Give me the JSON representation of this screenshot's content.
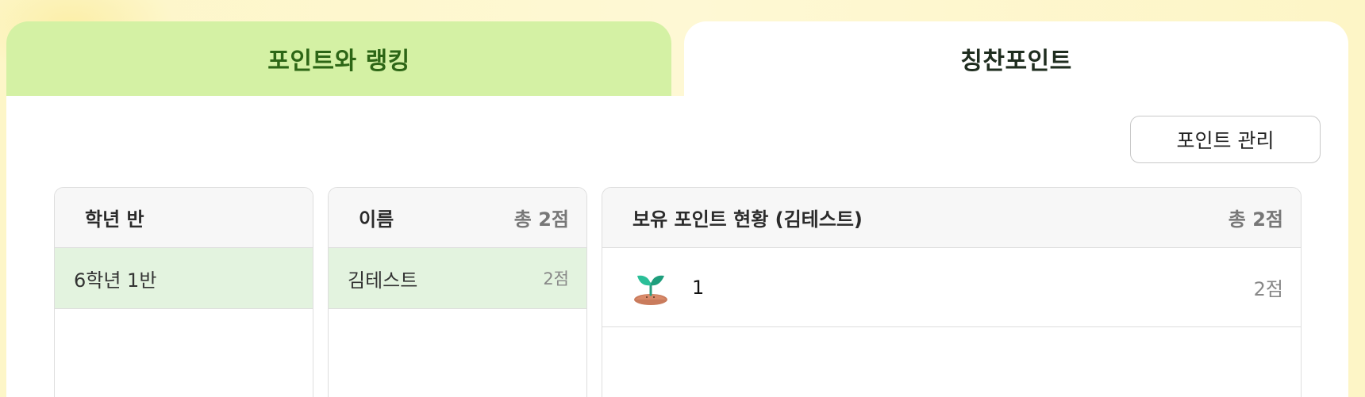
{
  "tabs": {
    "ranking": "포인트와 랭킹",
    "praise": "칭찬포인트"
  },
  "manage_button": "포인트 관리",
  "grade_column": {
    "header": "학년 반",
    "rows": [
      {
        "label": "6학년 1반",
        "selected": true
      }
    ]
  },
  "name_column": {
    "header": "이름",
    "total": "총 2점",
    "rows": [
      {
        "label": "김테스트",
        "value": "2점",
        "selected": true
      }
    ]
  },
  "points_column": {
    "header": "보유 포인트 현황 (김테스트)",
    "total": "총 2점",
    "rows": [
      {
        "icon": "sprout-icon",
        "label": "1",
        "value": "2점"
      }
    ]
  },
  "colors": {
    "active_tab_bg": "#d4f1a4",
    "active_tab_text": "#2d6616",
    "selected_row_bg": "#e3f3df"
  }
}
